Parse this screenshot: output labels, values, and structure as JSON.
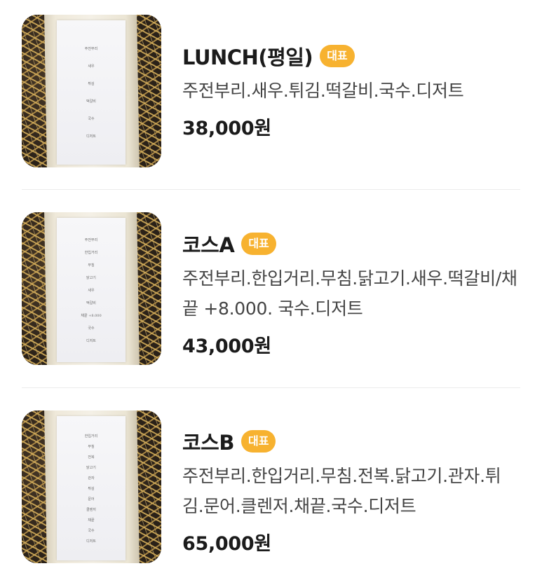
{
  "menu": {
    "items": [
      {
        "title": "LUNCH(평일)",
        "badge": "대표",
        "description": "주전부리.새우.튀김.떡갈비.국수.디저트",
        "price": "38,000원",
        "image_lines": [
          "주전부리",
          "새우",
          "튀김",
          "떡갈비",
          "국수",
          "디저트"
        ]
      },
      {
        "title": "코스A",
        "badge": "대표",
        "description": "주전부리.한입거리.무침.닭고기.새우.떡갈비/채끝 +8.000. 국수.디저트",
        "price": "43,000원",
        "image_lines": [
          "주전부리",
          "한입거리",
          "무침",
          "닭고기",
          "새우",
          "떡갈비",
          "채끝 +8.000",
          "국수",
          "디저트"
        ]
      },
      {
        "title": "코스B",
        "badge": "대표",
        "description": "주전부리.한입거리.무침.전복.닭고기.관자.튀김.문어.클렌저.채끝.국수.디저트",
        "price": "65,000원",
        "image_lines": [
          "한입거리",
          "무침",
          "전복",
          "닭고기",
          "관자",
          "튀김",
          "문어",
          "클렌저",
          "채끝",
          "국수",
          "디저트"
        ]
      }
    ]
  },
  "colors": {
    "badge": "#f7b230",
    "title": "#1b1b1b",
    "description": "#444444",
    "divider": "#ececec"
  }
}
